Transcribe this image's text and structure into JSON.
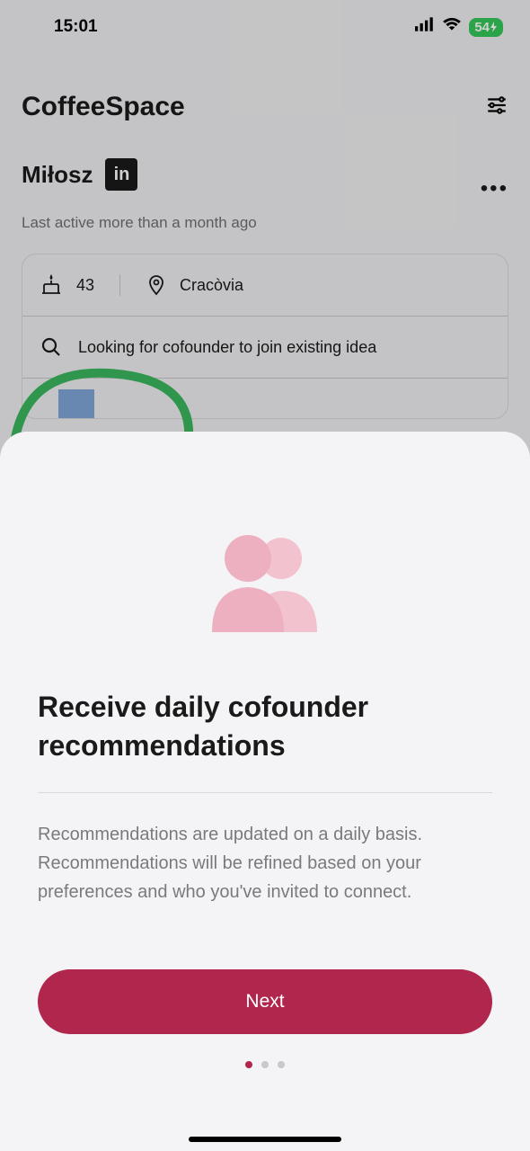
{
  "statusBar": {
    "time": "15:01",
    "battery": "54"
  },
  "header": {
    "appTitle": "CoffeeSpace"
  },
  "profile": {
    "name": "Miłosz",
    "lastActive": "Last active more than a month ago",
    "age": "43",
    "location": "Cracòvia",
    "lookingFor": "Looking for cofounder to join existing idea"
  },
  "modal": {
    "title": "Receive daily cofounder recommendations",
    "body": "Recommendations are updated on a daily basis. Recommendations will be refined based on your preferences and who you've invited to connect.",
    "nextLabel": "Next"
  }
}
